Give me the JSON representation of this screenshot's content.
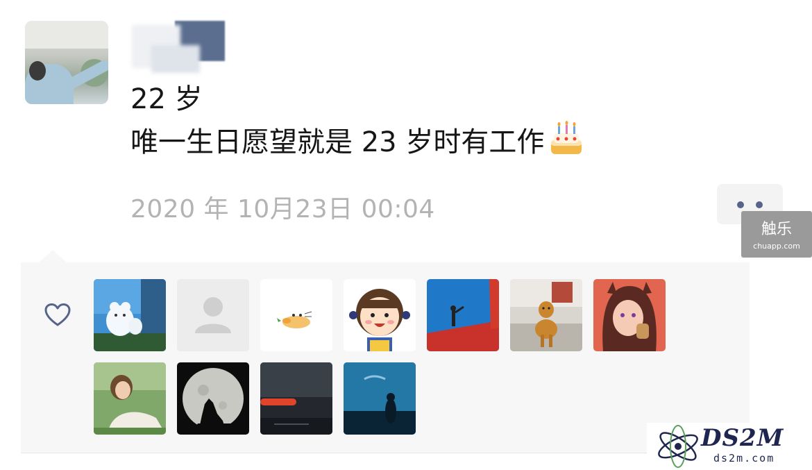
{
  "post": {
    "line1": "22 岁",
    "line2": "唯一生日愿望就是 23 岁时有工作",
    "emoji": "birthday-cake",
    "timestamp": "2020 年 10月23日 00:04"
  },
  "likes": {
    "icon": "heart-outline-icon",
    "avatars": [
      {
        "desc": "polar-bear-clouds"
      },
      {
        "desc": "default-avatar"
      },
      {
        "desc": "cartoon-rabbit-carrot"
      },
      {
        "desc": "cartoon-girl"
      },
      {
        "desc": "red-rooftop-figure"
      },
      {
        "desc": "dog"
      },
      {
        "desc": "anime-girl"
      },
      {
        "desc": "woman-portrait"
      },
      {
        "desc": "wolf-moon"
      },
      {
        "desc": "night-scene"
      },
      {
        "desc": "aquarium"
      }
    ]
  },
  "watermarks": {
    "chuapp_name": "触乐",
    "chuapp_url": "chuapp.com",
    "ds2m_name": "DS2M",
    "ds2m_url": "ds2m.com"
  },
  "colors": {
    "likes_bg": "#f7f7f7",
    "timestamp": "#b3b3b3",
    "accent": "#56648a"
  }
}
